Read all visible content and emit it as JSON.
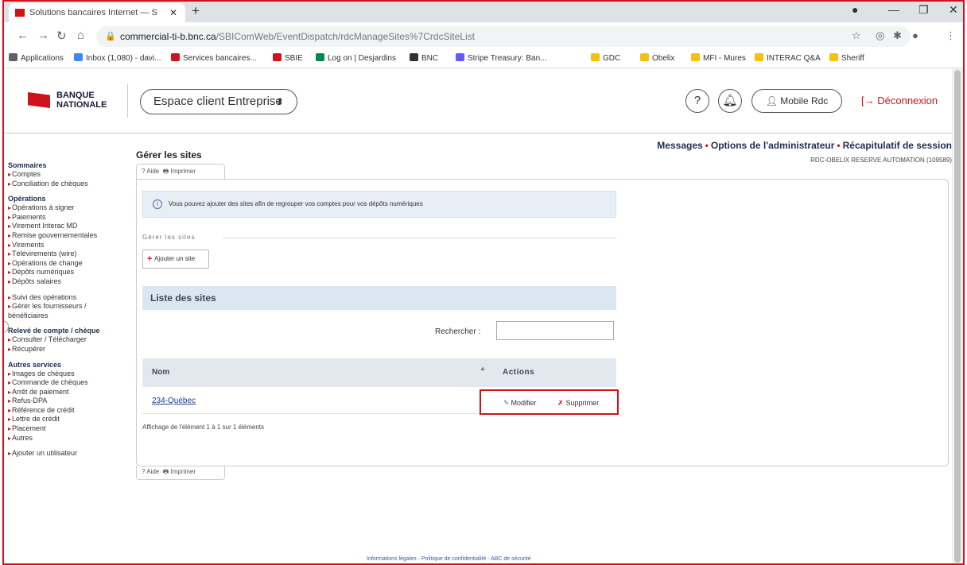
{
  "browser": {
    "tab_title": "Solutions bancaires Internet — S",
    "url_host": "commercial-ti-b.bnc.ca",
    "url_path": "/SBIComWeb/EventDispatch/rdcManageSites%7CrdcSiteList",
    "bookmarks": [
      {
        "label": "Applications",
        "color": "#5f6368"
      },
      {
        "label": "Inbox (1,080) - davi...",
        "color": "#4285f4"
      },
      {
        "label": "Services bancaires...",
        "color": "#d0121b"
      },
      {
        "label": "SBIE",
        "color": "#d0121b"
      },
      {
        "label": "Log on | Desjardins",
        "color": "#00874e"
      },
      {
        "label": "BNC",
        "color": "#333333"
      },
      {
        "label": "Stripe Treasury: Ban...",
        "color": "#635bff"
      },
      {
        "label": "GDC",
        "color": "#f4c20d"
      },
      {
        "label": "Obelix",
        "color": "#f4c20d"
      },
      {
        "label": "MFI - Mures",
        "color": "#f4c20d"
      },
      {
        "label": "INTERAC Q&A",
        "color": "#f4c20d"
      },
      {
        "label": "Sheriff",
        "color": "#f4c20d"
      }
    ]
  },
  "header": {
    "logo_line1": "BANQUE",
    "logo_line2": "NATIONALE",
    "space_selector": "Espace client Entreprise",
    "mobile_label": "Mobile Rdc",
    "logout_label": "Déconnexion"
  },
  "toplinks": {
    "messages": "Messages",
    "admin": "Options de l'administrateur",
    "summary": "Récapitulatif de session",
    "account": "RDC-OBELIX RESERVE AUTOMATION (109589)"
  },
  "sidebar": {
    "sections": [
      {
        "title": "Sommaires",
        "items": [
          "Comptes",
          "Conciliation de chèques"
        ]
      },
      {
        "title": "Opérations",
        "items": [
          "Opérations à signer",
          "Paiements",
          "Virement Interac MD",
          "Remise gouvernementales",
          "Virements",
          "Télévirements (wire)",
          "Opérations de change",
          "Dépôts numériques",
          "Dépôts salaires"
        ]
      },
      {
        "title": "",
        "items": [
          "Suivi des opérations",
          "Gérer les fournisseurs / bénéficiaires"
        ]
      },
      {
        "title": "Relevé de compte / chèque",
        "items": [
          "Consulter / Télécharger",
          "Récupérer"
        ]
      },
      {
        "title": "Autres services",
        "items": [
          "Images de chèques",
          "Commande de chèques",
          "Arrêt de paiement",
          "Refus-DPA",
          "Référence de crédit",
          "Lettre de crédit",
          "Placement",
          "Autres"
        ]
      },
      {
        "title": "",
        "items": [
          "Ajouter un utilisateur"
        ]
      }
    ]
  },
  "main": {
    "title": "Gérer les sites",
    "help": "Aide",
    "print": "Imprimer",
    "info_text": "Vous pouvez ajouter des sites afin de regrouper vos comptes pour vos dépôts numériques",
    "fieldset_label": "Gérer les sites",
    "add_button": "Ajouter un site",
    "list_header": "Liste des sites",
    "search_label": "Rechercher :",
    "col_name": "Nom",
    "col_actions": "Actions",
    "rows": [
      {
        "name": "234-Québec",
        "edit": "Modifier",
        "delete": "Supprimer"
      }
    ],
    "showing": "Affichage de l'élément 1 à 1 sur 1 éléments"
  },
  "footer": {
    "legal": "Informations légales",
    "privacy": "Politique de confidentialité",
    "security": "ABC de sécurité"
  }
}
